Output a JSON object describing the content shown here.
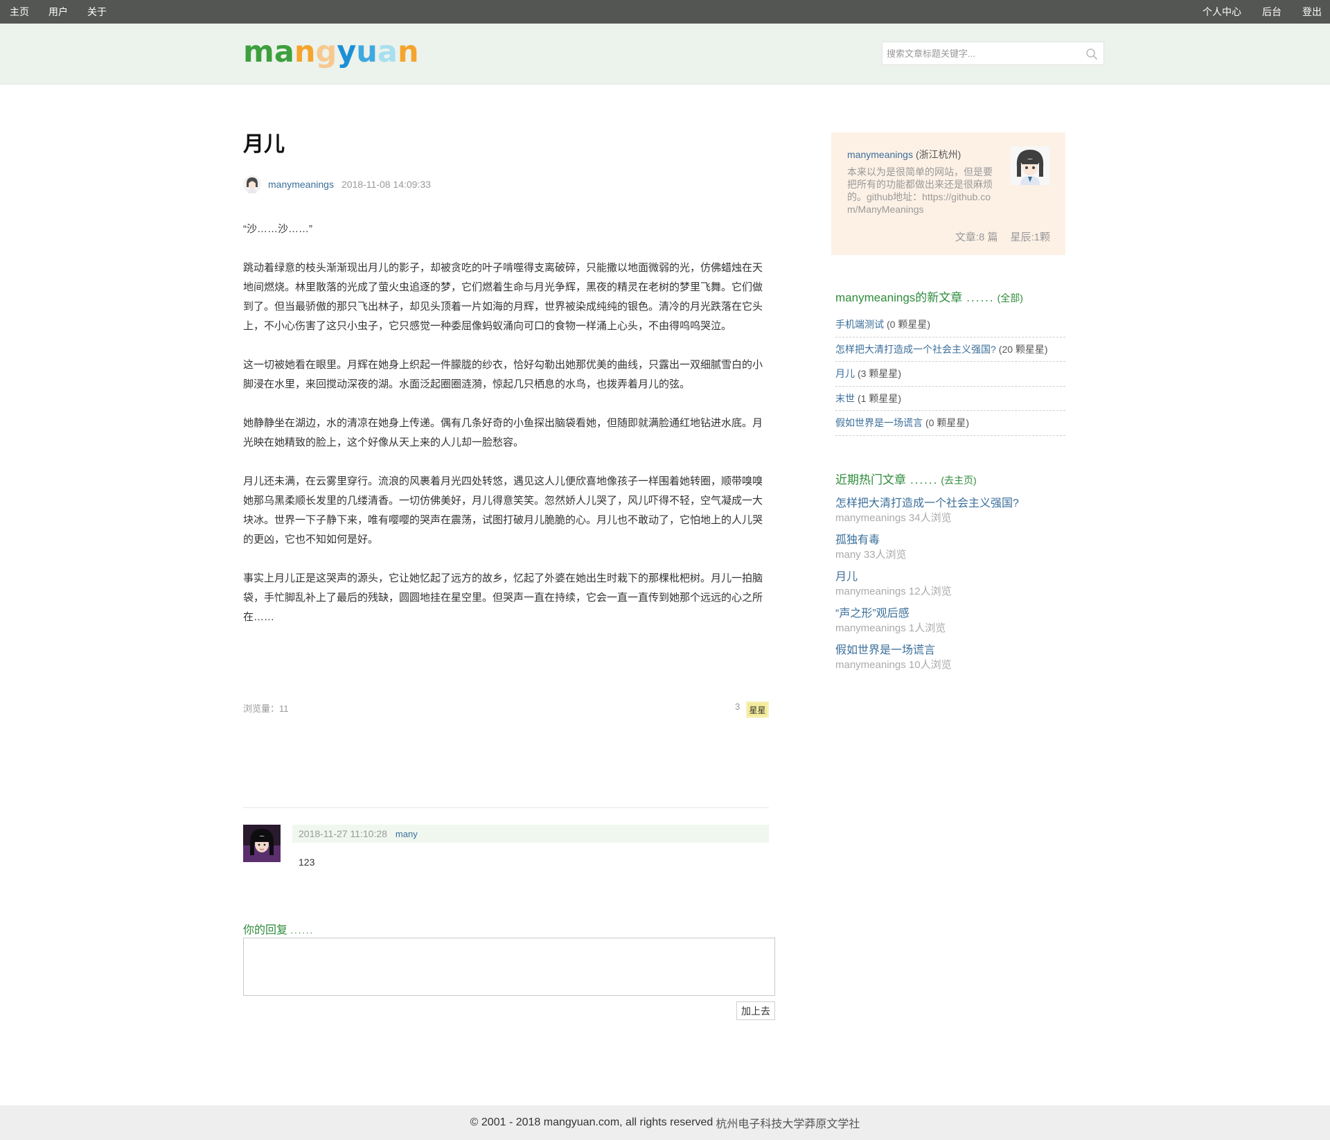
{
  "nav": {
    "left": [
      "主页",
      "用户",
      "关于"
    ],
    "right": [
      "个人中心",
      "后台",
      "登出"
    ]
  },
  "logo": {
    "letters": [
      "m",
      "a",
      "n",
      "g",
      "y",
      "u",
      "a",
      "n"
    ],
    "colors": [
      "#3d9f3d",
      "#3d9f3d",
      "#f5a42e",
      "#f7c98f",
      "#1c8fd6",
      "#3fa9e0",
      "#a7dfef",
      "#f5a42e"
    ]
  },
  "search": {
    "placeholder": "搜索文章标题关键字..."
  },
  "article": {
    "title": "月儿",
    "author": "manymeanings",
    "date": "2018-11-08 14:09:33",
    "paragraphs": [
      "“沙……沙……”",
      "跳动着绿意的枝头渐渐现出月儿的影子，却被贪吃的叶子啃噬得支离破碎，只能撒以地面微弱的光，仿佛蜡烛在天地间燃烧。林里散落的光成了萤火虫追逐的梦，它们燃着生命与月光争辉，黑夜的精灵在老树的梦里飞舞。它们做到了。但当最骄傲的那只飞出林子，却见头顶着一片如海的月辉，世界被染成纯纯的银色。清冷的月光跌落在它头上，不小心伤害了这只小虫子，它只感觉一种委屈像蚂蚁涌向可口的食物一样涌上心头，不由得呜呜哭泣。",
      "这一切被她看在眼里。月辉在她身上织起一件朦胧的纱衣，恰好勾勒出她那优美的曲线，只露出一双细腻雪白的小脚浸在水里，来回搅动深夜的湖。水面泛起圈圈涟漪，惊起几只栖息的水鸟，也拨弄着月儿的弦。",
      "她静静坐在湖边，水的清凉在她身上传递。偶有几条好奇的小鱼探出脑袋看她，但随即就满脸通红地钻进水底。月光映在她精致的脸上，这个好像从天上来的人儿却一脸愁容。",
      "月儿还未满，在云雾里穿行。流浪的风裹着月光四处转悠，遇见这人儿便欣喜地像孩子一样围着她转圈，顺带嗅嗅她那乌黑柔顺长发里的几缕清香。一切仿佛美好，月儿得意笑笑。忽然娇人儿哭了，风儿吓得不轻，空气凝成一大块冰。世界一下子静下来，唯有嘤嘤的哭声在震荡，试图打破月儿脆脆的心。月儿也不敢动了，它怕地上的人儿哭的更凶，它也不知如何是好。",
      "事实上月儿正是这哭声的源头，它让她忆起了远方的故乡，忆起了外婆在她出生时栽下的那棵枇杷树。月儿一拍脑袋，手忙脚乱补上了最后的残缺，圆圆地挂在星空里。但哭声一直在持续，它会一直一直传到她那个远远的心之所在……"
    ],
    "views_label": "浏览量：",
    "views": "11",
    "stars": "3",
    "star_button": "星星"
  },
  "comment": {
    "date": "2018-11-27 11:10:28",
    "user": "many",
    "text": "123"
  },
  "reply": {
    "label": "你的回复",
    "dots": "......",
    "submit": "加上去"
  },
  "profile": {
    "name": "manymeanings",
    "location": "(浙江杭州)",
    "description": "本来以为是很简单的网站，但是要把所有的功能都做出来还是很麻烦的。github地址：https://github.com/ManyMeanings",
    "articles": "文章:8 篇",
    "stars": "星辰:1颗"
  },
  "new_articles": {
    "title": "manymeanings的新文章",
    "dots": "......",
    "more": "(全部)",
    "items": [
      {
        "title": "手机端测试",
        "stars": "(0 颗星星)"
      },
      {
        "title": "怎样把大清打造成一个社会主义强国?",
        "stars": "(20 颗星星)"
      },
      {
        "title": "月儿",
        "stars": "(3 颗星星)"
      },
      {
        "title": "末世",
        "stars": "(1 颗星星)"
      },
      {
        "title": "假如世界是一场谎言",
        "stars": "(0 颗星星)"
      }
    ]
  },
  "hot_articles": {
    "title": "近期热门文章",
    "dots": "......",
    "more": "(去主页)",
    "items": [
      {
        "title": "怎样把大清打造成一个社会主义强国?",
        "meta": "manymeanings 34人浏览"
      },
      {
        "title": "孤独有毒",
        "meta": "many 33人浏览"
      },
      {
        "title": "月儿",
        "meta": "manymeanings 12人浏览"
      },
      {
        "title": "“声之形”观后感",
        "meta": "manymeanings 1人浏览"
      },
      {
        "title": "假如世界是一场谎言",
        "meta": "manymeanings 10人浏览"
      }
    ]
  },
  "footer": {
    "copyright": "© 2001 - 2018 mangyuan.com, all rights reserved",
    "school": "杭州电子科技大学莽原文学社"
  }
}
